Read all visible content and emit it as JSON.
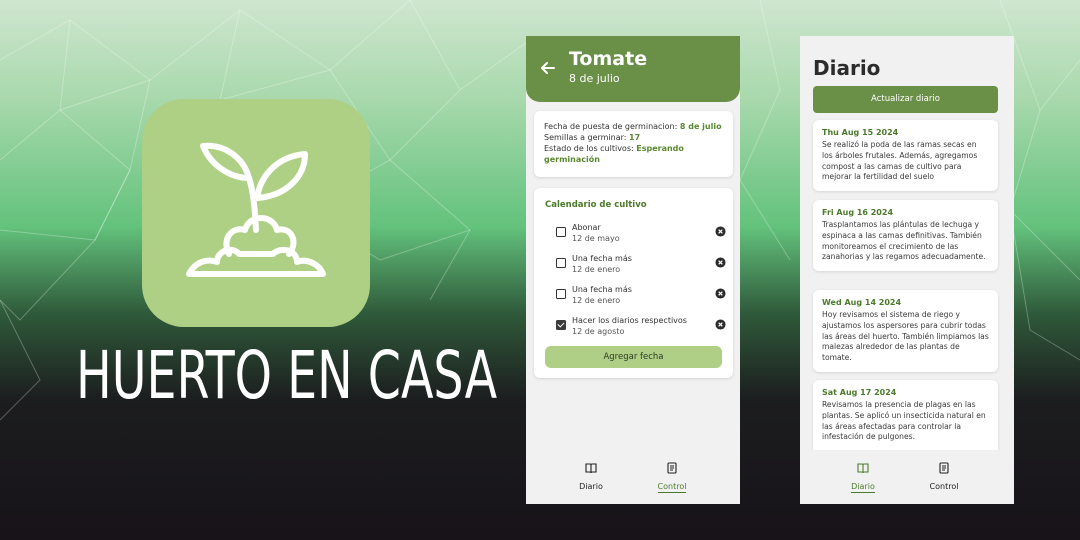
{
  "brand": {
    "title": "HUERTO EN CASA",
    "icon": "sprout-icon",
    "icon_bg": "#aed084"
  },
  "colors": {
    "primary": "#6a8f46",
    "accent_light": "#aecf85",
    "green_text": "#4c7a2c"
  },
  "screen_control": {
    "header": {
      "title": "Tomate",
      "subtitle": "8 de julio",
      "back_icon": "arrow-left-icon"
    },
    "info": {
      "germination_label": "Fecha de puesta de germinacion:",
      "germination_value": "8 de julio",
      "seeds_label": "Semillas a germinar:",
      "seeds_value": "17",
      "state_label": "Estado de los cultivos:",
      "state_value": "Esperando germinación"
    },
    "calendar": {
      "title": "Calendario de cultivo",
      "items": [
        {
          "name": "Abonar",
          "date": "12 de mayo",
          "checked": false
        },
        {
          "name": "Una fecha más",
          "date": "12 de enero",
          "checked": false
        },
        {
          "name": "Una fecha más",
          "date": "12 de enero",
          "checked": false
        },
        {
          "name": "Hacer los diarios respectivos",
          "date": "12 de agosto",
          "checked": true
        }
      ],
      "add_button": "Agregar fecha"
    },
    "nav": [
      {
        "label": "Diario",
        "icon": "book-icon",
        "active": false
      },
      {
        "label": "Control",
        "icon": "clipboard-icon",
        "active": true
      }
    ]
  },
  "screen_diario": {
    "title": "Diario",
    "update_button": "Actualizar diario",
    "entries": [
      {
        "date": "Thu Aug 15 2024",
        "text": "Se realizó la poda de las ramas secas en los árboles frutales. Además, agregamos compost a las camas de cultivo para mejorar la fertilidad del suelo"
      },
      {
        "date": "Fri Aug 16 2024",
        "text": "Trasplantamos las plántulas de lechuga y espinaca a las camas definitivas. También monitoreamos el crecimiento de las zanahorias y las regamos adecuadamente."
      },
      {
        "date": "Wed Aug 14 2024",
        "text": "Hoy revisamos el sistema de riego y ajustamos los aspersores para cubrir todas las áreas del huerto. También limpiamos las malezas alrededor de las plantas de tomate."
      },
      {
        "date": "Sat Aug 17 2024",
        "text": "Revisamos la presencia de plagas en las plantas. Se aplicó un insecticida natural en las áreas afectadas para controlar la infestación de pulgones."
      }
    ],
    "nav": [
      {
        "label": "Diario",
        "icon": "book-icon",
        "active": true
      },
      {
        "label": "Control",
        "icon": "clipboard-icon",
        "active": false
      }
    ]
  }
}
